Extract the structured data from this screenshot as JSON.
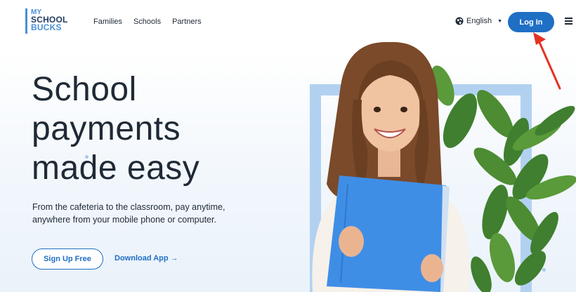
{
  "logo": {
    "line1": "MY",
    "line2": "SCHOOL",
    "line3": "BUCKS"
  },
  "nav": {
    "links": [
      "Families",
      "Schools",
      "Partners"
    ]
  },
  "language": {
    "label": "English"
  },
  "login": {
    "label": "Log In"
  },
  "hero": {
    "title_lines": [
      "School",
      "payments",
      "made easy"
    ],
    "subtitle": "From the cafeteria to the classroom, pay anytime, anywhere from your mobile phone or computer.",
    "signup_label": "Sign Up Free",
    "download_label": "Download App →"
  },
  "colors": {
    "accent": "#1f6fc5",
    "logo_blue": "#4a8fd6",
    "frame": "#b2d1f1",
    "annotation_arrow": "#e53222",
    "notebook": "#3f8ee6"
  },
  "icons": {
    "language": "globe-icon",
    "menu": "hamburger-menu-icon",
    "annotation": "red-arrow-annotation"
  }
}
